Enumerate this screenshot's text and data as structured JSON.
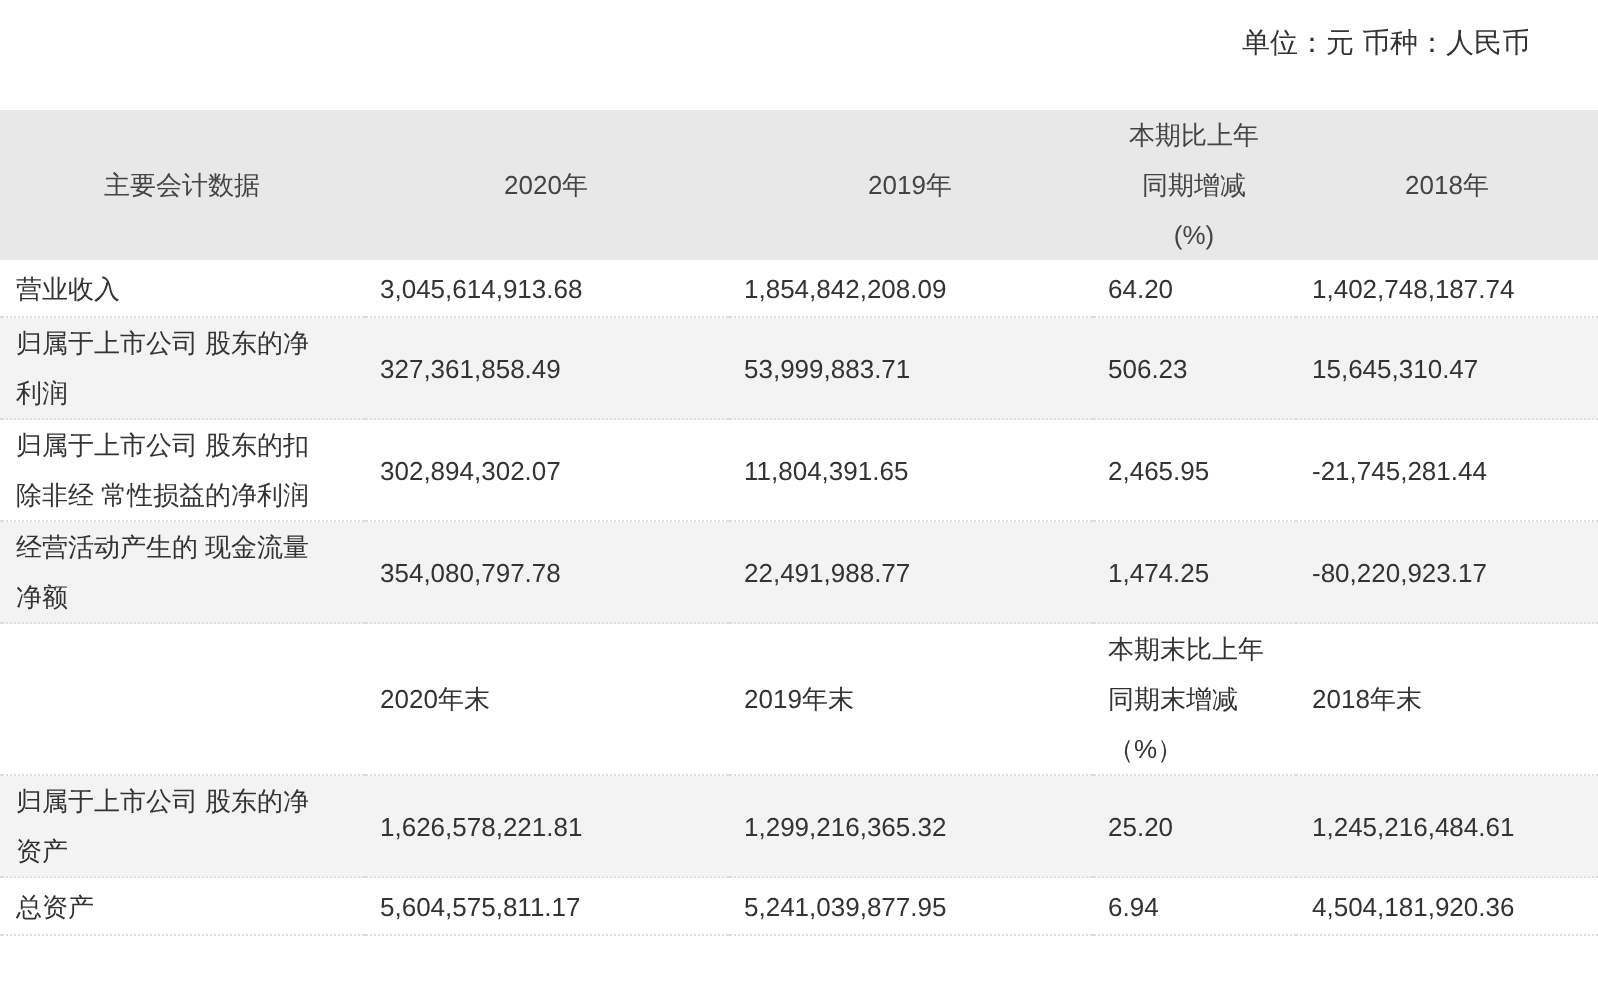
{
  "unit_note": "单位：元 币种：人民币",
  "table": {
    "columns": [
      "主要会计数据",
      "2020年",
      "2019年",
      "本期比上年同期增减(%)",
      "2018年"
    ],
    "rows": [
      {
        "kind": "data",
        "cells": [
          "营业收入",
          "3,045,614,913.68",
          "1,854,842,208.09",
          "64.20",
          "1,402,748,187.74"
        ]
      },
      {
        "kind": "data",
        "cells": [
          "归属于上市公司 股东的净利润",
          "327,361,858.49",
          "53,999,883.71",
          "506.23",
          "15,645,310.47"
        ]
      },
      {
        "kind": "data",
        "cells": [
          "归属于上市公司 股东的扣除非经 常性损益的净利润",
          "302,894,302.07",
          "11,804,391.65",
          "2,465.95",
          "-21,745,281.44"
        ]
      },
      {
        "kind": "data",
        "cells": [
          "经营活动产生的 现金流量净额",
          "354,080,797.78",
          "22,491,988.77",
          "1,474.25",
          "-80,220,923.17"
        ]
      },
      {
        "kind": "subheader",
        "cells": [
          "",
          "2020年末",
          "2019年末",
          "本期末比上年同期末增减（%）",
          "2018年末"
        ]
      },
      {
        "kind": "data",
        "cells": [
          "归属于上市公司 股东的净资产",
          "1,626,578,221.81",
          "1,299,216,365.32",
          "25.20",
          "1,245,216,484.61"
        ]
      },
      {
        "kind": "data",
        "cells": [
          "总资产",
          "5,604,575,811.17",
          "5,241,039,877.95",
          "6.94",
          "4,504,181,920.36"
        ]
      }
    ]
  }
}
